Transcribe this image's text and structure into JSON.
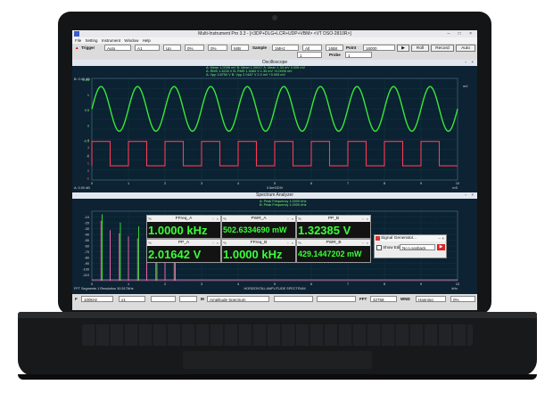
{
  "app": {
    "title": "Multi-Instrument Pro 3.3 - [<3DP+DLG+LCR+UDP+VBM> <VT DSO-2810R>]",
    "window_buttons": "– □ ×"
  },
  "menu": [
    "File",
    "Setting",
    "Instrument",
    "Window",
    "Help"
  ],
  "toolbar": {
    "trigger_label": "Trigger",
    "trigger_mode": "Auto",
    "trigger_source": "A1",
    "trigger_edge": "Up",
    "trigger_level": "0%",
    "pretrigger": "0%",
    "mode_sel": "M/B",
    "sample_label": "Sample",
    "sample_rate": "1MHz",
    "record_len": "All",
    "bits": "16Bit",
    "point_label": "Point",
    "point_value": "16000",
    "probe_label": "Probe",
    "probe_value": "1",
    "roll_label": "Roll",
    "record_label": "Record",
    "auto_label": "Auto",
    "cont_label": "1"
  },
  "oscilloscope": {
    "title": "Oscilloscope",
    "readouts": [
      "A: Mean 1.0098 mV   B: Mean 1.00017   A: Mean 1.33 mV  0.005 mV",
      "A: RMS  1.3226 V    B: RMS  1.0084 V  1.35 mV  +0.0005 mV",
      "A: Vpp  3.8750 V    B: Vpp  2.0187 V  2.0 mV   +0.005 mV"
    ],
    "y_ticks_a": [
      "0.13",
      "1",
      "0.5",
      "0",
      "-0.5",
      "-1"
    ],
    "y_ticks_b": [
      "4",
      "3",
      "2",
      "1",
      "0",
      "-1"
    ],
    "x_ticks": [
      "0",
      "1",
      "2",
      "3",
      "4",
      "5",
      "6",
      "7",
      "8",
      "9",
      "10"
    ],
    "x_label": "0.5mS/DIV",
    "x_unit": "mS",
    "corner_left": "A: 0.00 dB",
    "corner_right": "B: 0.00 dB",
    "right_unit": "mV",
    "colors": {
      "sine": "#39e839",
      "square": "#ff3a55",
      "grid": "#2f5a6b"
    }
  },
  "spectrum": {
    "title": "Spectrum Analyzer",
    "readouts": [
      "A: Peak Frequency 1.0000 kHz",
      "B: Peak Frequency 1.0000 kHz"
    ],
    "y_ticks": [
      "-10",
      "-20",
      "-30",
      "-40",
      "-50",
      "-60",
      "-70",
      "-80",
      "-90",
      "-100",
      "-110"
    ],
    "x_ticks": [
      "0",
      "1",
      "2",
      "3",
      "4",
      "5",
      "6",
      "7",
      "8",
      "9",
      "10"
    ],
    "x_label": "HORIZONTAL AMPLITUDE SPECTRUM",
    "x_unit": "kHz",
    "footer_left": "FFT Segments  1   Resolution  30.5176Hz",
    "colors": {
      "spec_a": "#39e839",
      "spec_b": "#ff69b4"
    }
  },
  "meters": [
    {
      "name": "FFreq_A",
      "value": "1.0000 kHz"
    },
    {
      "name": "PWR_A",
      "value": "502.6334690 mW"
    },
    {
      "name": "PP_B",
      "value": "1.32385 V"
    },
    {
      "name": "PP_A",
      "value": "2.01642 V"
    },
    {
      "name": "FFreq_B",
      "value": "1.0000 kHz"
    },
    {
      "name": "PWR_B",
      "value": "429.1447202 mW"
    }
  ],
  "signal_generator": {
    "title": "Signal Generator...",
    "show_editor_label": "Show Editor",
    "waveform": "No Loopback"
  },
  "bottombar": {
    "ch_label": "F",
    "freq_range": "100kHz",
    "range_b": "x1",
    "mode_label": "M",
    "mode_value": "Amplitude Spectrum",
    "fft_label": "FFT",
    "fft_size": "32768",
    "wnd_label": "WND",
    "wnd_value": "Hanning",
    "pct": "0%"
  },
  "chart_data": [
    {
      "type": "line",
      "title": "Oscilloscope",
      "xlabel": "0.5mS/DIV",
      "x": [
        0,
        1,
        2,
        3,
        4,
        5,
        6,
        7,
        8,
        9,
        10
      ],
      "xlim": [
        0,
        10
      ],
      "series": [
        {
          "name": "A",
          "waveform": "sine",
          "cycles": 10,
          "amplitude": 1.0
        },
        {
          "name": "B",
          "waveform": "square",
          "cycles": 10,
          "levels": [
            0,
            1
          ]
        }
      ],
      "grid": true
    },
    {
      "type": "bar",
      "title": "Spectrum Analyzer",
      "xlabel": "HORIZONTAL AMPLITUDE SPECTRUM",
      "xlim": [
        0,
        10
      ],
      "ylim": [
        -110,
        0
      ],
      "series": [
        {
          "name": "A",
          "peak_freq_khz": 1.0,
          "harmonics_khz": [
            1,
            3,
            5,
            7,
            9
          ],
          "values_db": [
            -5,
            -18,
            -24,
            -28,
            -31
          ]
        },
        {
          "name": "B",
          "peak_freq_khz": 1.0,
          "harmonics_khz": [
            1,
            2,
            3,
            4,
            5,
            6,
            7,
            8,
            9
          ],
          "values_db": [
            -15,
            -30,
            -35,
            -40,
            -43,
            -46,
            -49,
            -52,
            -55
          ]
        }
      ],
      "grid": true
    }
  ]
}
